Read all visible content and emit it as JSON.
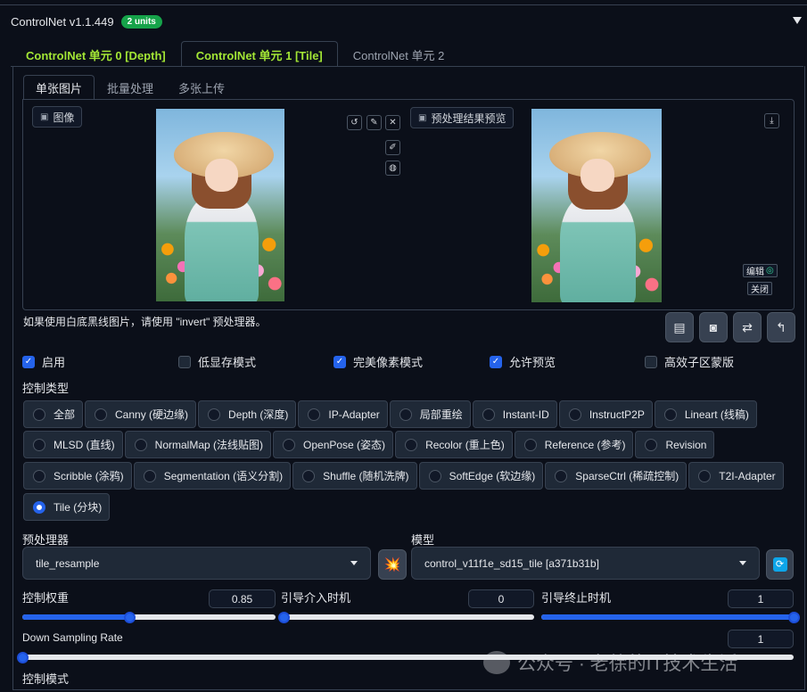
{
  "header": {
    "title": "ControlNet v1.1.449",
    "badge": "2 units"
  },
  "unit_tabs": [
    {
      "label": "ControlNet 单元 0 [Depth]"
    },
    {
      "label": "ControlNet 单元 1 [Tile]"
    },
    {
      "label": "ControlNet 单元 2"
    }
  ],
  "image_tabs": [
    {
      "label": "单张图片"
    },
    {
      "label": "批量处理"
    },
    {
      "label": "多张上传"
    }
  ],
  "image_panel": {
    "input_label": "图像",
    "preview_label": "预处理结果预览",
    "edit_label": "编辑",
    "close_label": "关闭"
  },
  "hint": "如果使用白底黑线图片，请使用 \"invert\" 预处理器。",
  "checkboxes": [
    {
      "label": "启用",
      "checked": true
    },
    {
      "label": "低显存模式",
      "checked": false
    },
    {
      "label": "完美像素模式",
      "checked": true
    },
    {
      "label": "允许预览",
      "checked": true
    },
    {
      "label": "高效子区蒙版",
      "checked": false
    }
  ],
  "control_type": {
    "label": "控制类型",
    "options": [
      "全部",
      "Canny (硬边缘)",
      "Depth (深度)",
      "IP-Adapter",
      "局部重绘",
      "Instant-ID",
      "InstructP2P",
      "Lineart (线稿)",
      "MLSD (直线)",
      "NormalMap (法线贴图)",
      "OpenPose (姿态)",
      "Recolor (重上色)",
      "Reference (参考)",
      "Revision",
      "Scribble (涂鸦)",
      "Segmentation (语义分割)",
      "Shuffle (随机洗牌)",
      "SoftEdge (软边缘)",
      "SparseCtrl (稀疏控制)",
      "T2I-Adapter",
      "Tile (分块)"
    ],
    "selected": "Tile (分块)"
  },
  "preprocessor": {
    "label": "预处理器",
    "value": "tile_resample"
  },
  "model": {
    "label": "模型",
    "value": "control_v11f1e_sd15_tile [a371b31b]"
  },
  "sliders": {
    "weight": {
      "label": "控制权重",
      "value": "0.85",
      "fraction": 0.425
    },
    "start": {
      "label": "引导介入时机",
      "value": "0",
      "fraction": 0
    },
    "end": {
      "label": "引导终止时机",
      "value": "1",
      "fraction": 1
    },
    "down_sampling": {
      "label": "Down Sampling Rate",
      "value": "1",
      "fraction": 0
    }
  },
  "control_mode": {
    "label": "控制模式"
  },
  "watermark": {
    "text": "公众号 · 老徐的IT技术生活"
  },
  "colors": {
    "accent": "#2563eb",
    "unit_green": "#a3e635",
    "badge": "#16a34a"
  }
}
